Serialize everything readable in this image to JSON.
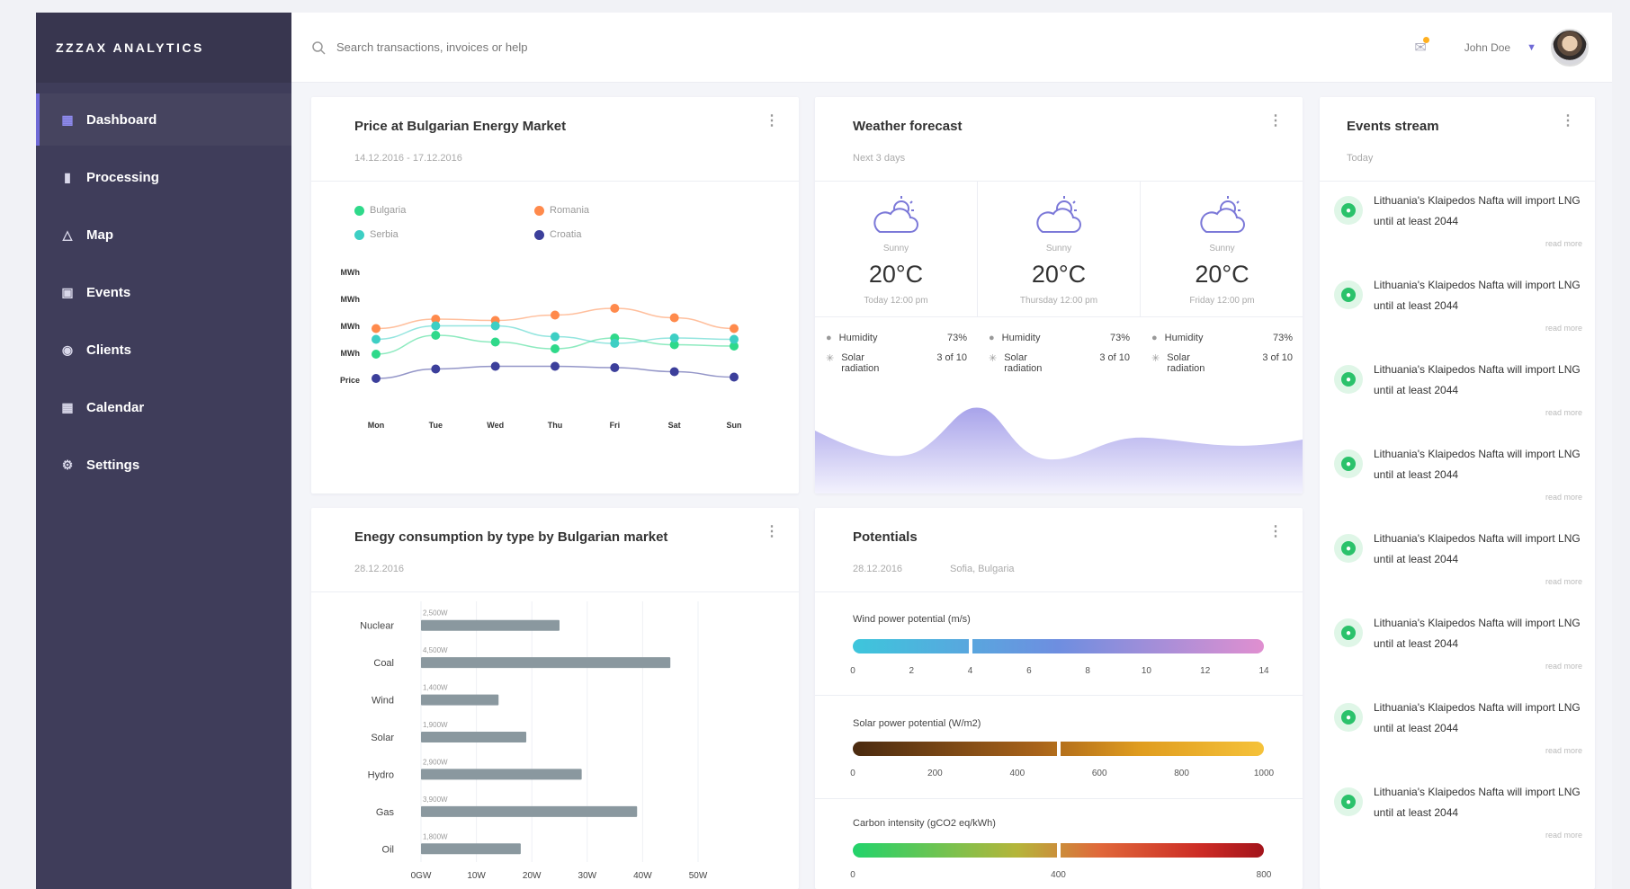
{
  "app": {
    "brand": "ZZZAX ANALYTICS"
  },
  "sidebar": {
    "items": [
      {
        "label": "Dashboard",
        "icon": "grid-icon",
        "active": true
      },
      {
        "label": "Processing",
        "icon": "bar-chart-icon",
        "active": false
      },
      {
        "label": "Map",
        "icon": "map-icon",
        "active": false
      },
      {
        "label": "Events",
        "icon": "events-icon",
        "active": false
      },
      {
        "label": "Clients",
        "icon": "clients-icon",
        "active": false
      },
      {
        "label": "Calendar",
        "icon": "calendar-icon",
        "active": false
      },
      {
        "label": "Settings",
        "icon": "settings-icon",
        "active": false
      }
    ]
  },
  "topbar": {
    "search_placeholder": "Search transactions, invoices or help",
    "username": "John Doe"
  },
  "colors": {
    "sidebar_bg": "#3f3d5a",
    "accent": "#6f6ad6",
    "bulgaria": "#2fd98a",
    "romania": "#ff8a4c",
    "serbia": "#3dcfc4",
    "croatia": "#3c3f9b",
    "bar": "#8a989f",
    "event_green": "#2bc26b"
  },
  "price_card": {
    "title": "Price at Bulgarian Energy Market",
    "subtitle": "14.12.2016 - 17.12.2016",
    "menu": "⋮"
  },
  "weather_card": {
    "title": "Weather forecast",
    "subtitle": "Next 3 days",
    "menu": "⋮",
    "days": [
      {
        "condition": "Sunny",
        "temp": "20°C",
        "time": "Today 12:00 pm",
        "humidity_label": "Humidity",
        "humidity": "73%",
        "solar_label": "Solar radiation",
        "solar": "3 of 10"
      },
      {
        "condition": "Sunny",
        "temp": "20°C",
        "time": "Thursday 12:00 pm",
        "humidity_label": "Humidity",
        "humidity": "73%",
        "solar_label": "Solar radiation",
        "solar": "3 of 10"
      },
      {
        "condition": "Sunny",
        "temp": "20°C",
        "time": "Friday 12:00 pm",
        "humidity_label": "Humidity",
        "humidity": "73%",
        "solar_label": "Solar radiation",
        "solar": "3 of 10"
      }
    ]
  },
  "events_card": {
    "title": "Events stream",
    "subtitle": "Today",
    "menu": "⋮",
    "items": [
      {
        "text": "Lithuania's Klaipedos Nafta will import LNG until at least 2044",
        "more": "read more"
      },
      {
        "text": "Lithuania's Klaipedos Nafta will import LNG until at least 2044",
        "more": "read more"
      },
      {
        "text": "Lithuania's Klaipedos Nafta will import LNG until at least 2044",
        "more": "read more"
      },
      {
        "text": "Lithuania's Klaipedos Nafta will import LNG until at least 2044",
        "more": "read more"
      },
      {
        "text": "Lithuania's Klaipedos Nafta will import LNG until at least 2044",
        "more": "read more"
      },
      {
        "text": "Lithuania's Klaipedos Nafta will import LNG until at least 2044",
        "more": "read more"
      },
      {
        "text": "Lithuania's Klaipedos Nafta will import LNG until at least 2044",
        "more": "read more"
      },
      {
        "text": "Lithuania's Klaipedos Nafta will import LNG until at least 2044",
        "more": "read more"
      }
    ]
  },
  "consumption_card": {
    "title": "Enegy consumption by type by Bulgarian market",
    "subtitle": "28.12.2016",
    "menu": "⋮"
  },
  "potentials_card": {
    "title": "Potentials",
    "subtitle_date": "28.12.2016",
    "subtitle_place": "Sofia, Bulgaria",
    "menu": "⋮",
    "wind": {
      "label": "Wind power potential (m/s)",
      "ticks": [
        "0",
        "2",
        "4",
        "6",
        "8",
        "10",
        "12",
        "14"
      ],
      "value": 4
    },
    "solar": {
      "label": "Solar power potential (W/m2)",
      "ticks": [
        "0",
        "200",
        "400",
        "600",
        "800",
        "1000"
      ],
      "value": 500
    },
    "carbon": {
      "label": "Carbon intensity (gCO2 eq/kWh)",
      "ticks": [
        "0",
        "400",
        "800"
      ],
      "value": 400
    }
  },
  "chart_data": [
    {
      "type": "line",
      "x": [
        "Mon",
        "Tue",
        "Wed",
        "Thu",
        "Fri",
        "Sat",
        "Sun"
      ],
      "y_ticks": [
        "MWh",
        "MWh",
        "MWh",
        "MWh",
        "Price"
      ],
      "series": [
        {
          "name": "Bulgaria",
          "color": "#2fd98a",
          "values": [
            0.36,
            0.5,
            0.45,
            0.4,
            0.48,
            0.43,
            0.42
          ]
        },
        {
          "name": "Romania",
          "color": "#ff8a4c",
          "values": [
            0.55,
            0.62,
            0.61,
            0.65,
            0.7,
            0.63,
            0.55
          ]
        },
        {
          "name": "Serbia",
          "color": "#3dcfc4",
          "values": [
            0.47,
            0.57,
            0.57,
            0.49,
            0.44,
            0.48,
            0.47
          ]
        },
        {
          "name": "Croatia",
          "color": "#3c3f9b",
          "values": [
            0.18,
            0.25,
            0.27,
            0.27,
            0.26,
            0.23,
            0.19
          ]
        }
      ]
    },
    {
      "type": "bar",
      "categories": [
        "Nuclear",
        "Coal",
        "Wind",
        "Solar",
        "Hydro",
        "Gas",
        "Oil"
      ],
      "values": [
        2.5,
        4.5,
        1.4,
        1.9,
        2.9,
        3.9,
        1.8
      ],
      "data_labels": [
        "2,500W",
        "4,500W",
        "1,400W",
        "1,900W",
        "2,900W",
        "3,900W",
        "1,800W"
      ],
      "x_ticks": [
        "0GW",
        "10W",
        "20W",
        "30W",
        "40W",
        "50W"
      ],
      "xlim": [
        0,
        5
      ]
    }
  ]
}
